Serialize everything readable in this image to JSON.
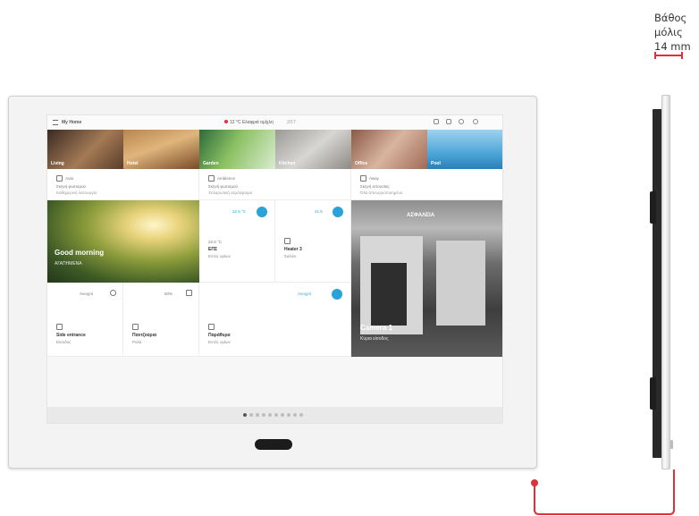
{
  "depth": {
    "line1": "Βάθος",
    "line2": "μόλις",
    "line3": "14 mm",
    "accent": "#e0303a"
  },
  "screen": {
    "status_title": "My Home",
    "weather": "12 °C  Ελαφριά ομίχλη",
    "weather2": "2/17",
    "tiles_row1": [
      {
        "line1": "Auto",
        "line2": "Σκηνή φωτισμού",
        "line3": "Καθημερινή λειτουργία"
      },
      {
        "line1": "Ambience",
        "line2": "Σκηνή φωτισμού",
        "line3": "Χαλαρωτική ατμόσφαιρα"
      },
      {
        "line1": "Away",
        "line2": "Σκηνή απουσίας",
        "line3": "Όλα απενεργοποιημένα"
      }
    ],
    "photo_captions": [
      "Living",
      "Hotel",
      "Garden",
      "Kitchen",
      "Office",
      "Pool"
    ],
    "hero_caption": "Good morning",
    "hero_sub": "ΑΓΑΠΗΜΕΝΑ",
    "thermo": {
      "value": "22.0 °C",
      "setpoint": "22.5 °C",
      "name": "ΕΠΣ",
      "sub": "Εντός ορίων"
    },
    "heater": {
      "value": "21.5",
      "name": "Heater 3",
      "sub": "Σαλόνι"
    },
    "entrance": {
      "value": "Ανοιχτό",
      "name": "Side entrance",
      "sub": "Είσοδος"
    },
    "blinds": {
      "value": "50%",
      "name": "Παντζούρια",
      "sub": "Ρολά"
    },
    "shutters": {
      "value": "Ανοιχτό",
      "name": "Παράθυρα",
      "sub": "Εντός ορίων"
    },
    "camera_header": "ΑΣΦΑΛΕΙΑ",
    "camera_caption": "Camera 1",
    "camera_sub": "Κύρια είσοδος",
    "dots_count": 10,
    "dots_active": 1,
    "accent": "#2aa3d9"
  }
}
